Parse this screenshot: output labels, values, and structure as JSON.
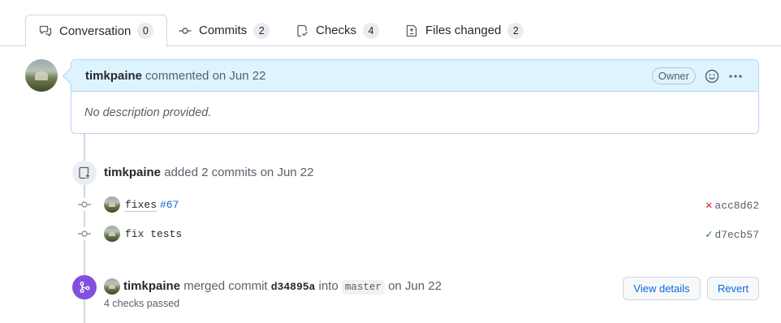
{
  "tabs": [
    {
      "label": "Conversation",
      "count": "0",
      "icon": "comment-discussion-icon",
      "selected": true
    },
    {
      "label": "Commits",
      "count": "2",
      "icon": "git-commit-icon"
    },
    {
      "label": "Checks",
      "count": "4",
      "icon": "checklist-icon"
    },
    {
      "label": "Files changed",
      "count": "2",
      "icon": "file-diff-icon"
    }
  ],
  "comment": {
    "author": "timkpaine",
    "action": "commented on Jun 22",
    "badge": "Owner",
    "body": "No description provided."
  },
  "commits_event": {
    "author": "timkpaine",
    "action": "added 2 commits on Jun 22",
    "commits": [
      {
        "message": "fixes",
        "issue": "#67",
        "sha": "acc8d62",
        "status": "failure",
        "status_symbol": "✕",
        "status_color": "#cf222e"
      },
      {
        "message": "fix tests",
        "sha": "d7ecb57",
        "status": "success",
        "status_symbol": "✓",
        "status_color": "#1a7f37"
      }
    ]
  },
  "merge_event": {
    "author": "timkpaine",
    "action_prefix": "merged commit",
    "commit_sha": "d34895a",
    "into": "into",
    "branch": "master",
    "date": "on Jun 22",
    "checks": "4 checks passed",
    "view_details": "View details",
    "revert": "Revert",
    "badge_color": "#8250df"
  }
}
